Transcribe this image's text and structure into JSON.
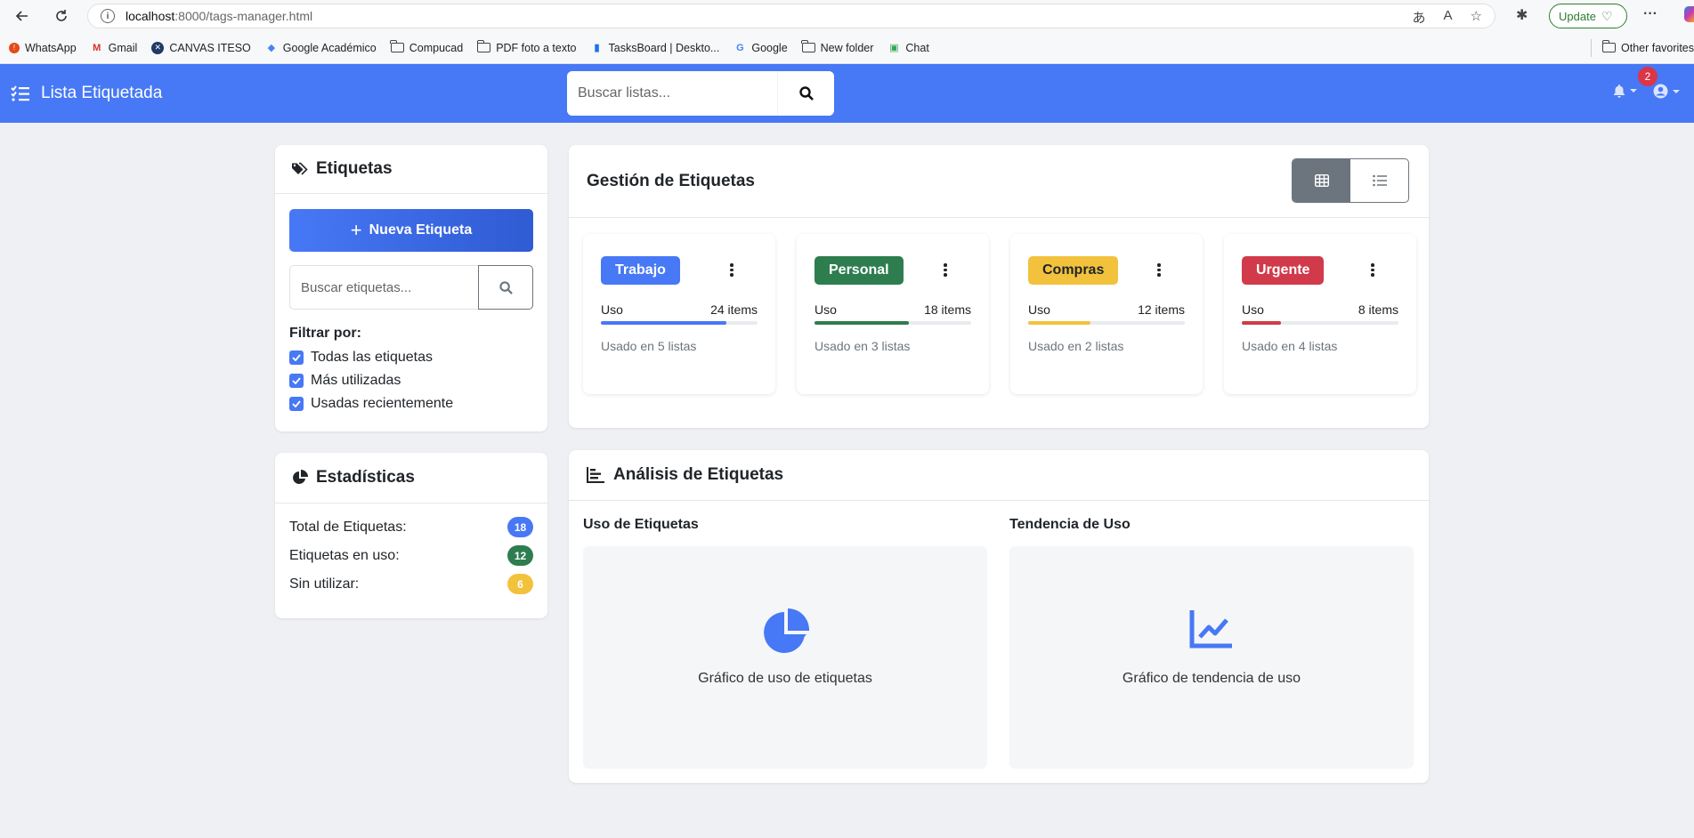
{
  "browser": {
    "url_host": "localhost",
    "url_path": ":8000/tags-manager.html",
    "update_label": "Update",
    "bookmarks": [
      "WhatsApp",
      "Gmail",
      "CANVAS ITESO",
      "Google Académico",
      "Compucad",
      "PDF foto a texto",
      "TasksBoard | Deskto...",
      "Google",
      "New folder",
      "Chat"
    ],
    "other_favorites": "Other favorites"
  },
  "navbar": {
    "brand": "Lista Etiquetada",
    "search_placeholder": "Buscar listas...",
    "notifications_count": "2"
  },
  "tags_panel": {
    "title": "Etiquetas",
    "new_tag_label": "Nueva Etiqueta",
    "search_placeholder": "Buscar etiquetas...",
    "filter_title": "Filtrar por:",
    "filters": [
      {
        "label": "Todas las etiquetas",
        "checked": true
      },
      {
        "label": "Más utilizadas",
        "checked": true
      },
      {
        "label": "Usadas recientemente",
        "checked": true
      }
    ]
  },
  "stats_panel": {
    "title": "Estadísticas",
    "rows": [
      {
        "label": "Total de Etiquetas:",
        "value": "18",
        "color": "#4778f5"
      },
      {
        "label": "Etiquetas en uso:",
        "value": "12",
        "color": "#2e7d4f"
      },
      {
        "label": "Sin utilizar:",
        "value": "6",
        "color": "#f2c23c"
      }
    ]
  },
  "manage": {
    "title": "Gestión de Etiquetas",
    "tags": [
      {
        "name": "Trabajo",
        "color": "#4778f5",
        "text_color": "#ffffff",
        "use_label": "Uso",
        "items": "24 items",
        "usage": 0.8,
        "used_in": "Usado en 5 listas"
      },
      {
        "name": "Personal",
        "color": "#2e7d4f",
        "text_color": "#ffffff",
        "use_label": "Uso",
        "items": "18 items",
        "usage": 0.6,
        "used_in": "Usado en 3 listas"
      },
      {
        "name": "Compras",
        "color": "#f2c23c",
        "text_color": "#212529",
        "use_label": "Uso",
        "items": "12 items",
        "usage": 0.4,
        "used_in": "Usado en 2 listas"
      },
      {
        "name": "Urgente",
        "color": "#d13a4a",
        "text_color": "#ffffff",
        "use_label": "Uso",
        "items": "8 items",
        "usage": 0.25,
        "used_in": "Usado en 4 listas"
      }
    ]
  },
  "analysis": {
    "title": "Análisis de Etiquetas",
    "usage_title": "Uso de Etiquetas",
    "usage_caption": "Gráfico de uso de etiquetas",
    "trend_title": "Tendencia de Uso",
    "trend_caption": "Gráfico de tendencia de uso"
  },
  "colors": {
    "primary": "#4778f5",
    "secondary": "#6c757d"
  }
}
